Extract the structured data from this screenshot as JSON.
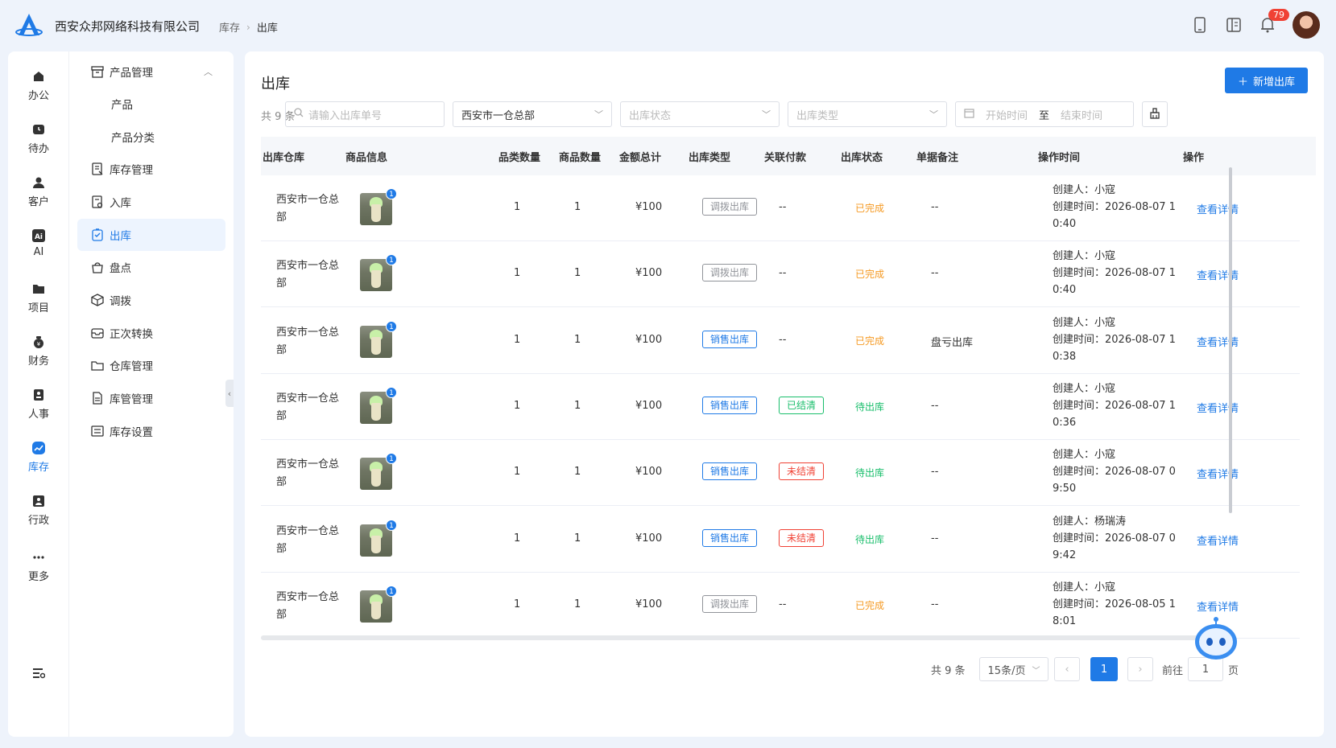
{
  "header": {
    "company": "西安众邦网络科技有限公司",
    "breadcrumb": [
      "库存",
      "出库"
    ],
    "notification_count": "79"
  },
  "rail": [
    {
      "label": "办公",
      "icon": "home-icon"
    },
    {
      "label": "待办",
      "icon": "clock-icon"
    },
    {
      "label": "客户",
      "icon": "user-icon"
    },
    {
      "label": "AI",
      "icon": "ai-icon"
    },
    {
      "label": "项目",
      "icon": "folder-icon"
    },
    {
      "label": "财务",
      "icon": "money-bag-icon"
    },
    {
      "label": "人事",
      "icon": "badge-icon"
    },
    {
      "label": "库存",
      "icon": "trend-icon",
      "active": true
    },
    {
      "label": "行政",
      "icon": "admin-icon"
    },
    {
      "label": "更多",
      "icon": "more-icon"
    }
  ],
  "submenu": [
    {
      "label": "产品管理",
      "icon": "box-icon",
      "expanded": true
    },
    {
      "label": "产品",
      "child": true
    },
    {
      "label": "产品分类",
      "child": true
    },
    {
      "label": "库存管理",
      "icon": "doc-edit-icon"
    },
    {
      "label": "入库",
      "icon": "doc-in-icon"
    },
    {
      "label": "出库",
      "icon": "doc-out-icon",
      "active": true
    },
    {
      "label": "盘点",
      "icon": "bag-icon"
    },
    {
      "label": "调拨",
      "icon": "cube-icon"
    },
    {
      "label": "正次转换",
      "icon": "inbox-icon"
    },
    {
      "label": "仓库管理",
      "icon": "folder-open-icon"
    },
    {
      "label": "库管管理",
      "icon": "file-icon"
    },
    {
      "label": "库存设置",
      "icon": "list-icon"
    }
  ],
  "page": {
    "title": "出库",
    "new_button": "新增出库",
    "total": "共 9 条"
  },
  "filters": {
    "search_placeholder": "请输入出库单号",
    "warehouse": "西安市一仓总部",
    "status_placeholder": "出库状态",
    "type_placeholder": "出库类型",
    "start_placeholder": "开始时间",
    "range_sep": "至",
    "end_placeholder": "结束时间"
  },
  "table": {
    "columns": [
      "出库仓库",
      "商品信息",
      "品类数量",
      "商品数量",
      "金额总计",
      "出库类型",
      "关联付款",
      "出库状态",
      "单据备注",
      "操作时间",
      "操作"
    ],
    "rows": [
      {
        "warehouse": "西安市一仓总部",
        "qty_badge": "1",
        "cat_qty": "1",
        "goods_qty": "1",
        "amount": "¥100",
        "type": "调拨出库",
        "type_color": "gray",
        "payment": "--",
        "payment_tag": "",
        "status": "已完成",
        "status_color": "orange",
        "remark": "--",
        "creator": "创建人：小寇",
        "time": "创建时间：2026-08-07 10:40",
        "action": "查看详情"
      },
      {
        "warehouse": "西安市一仓总部",
        "qty_badge": "1",
        "cat_qty": "1",
        "goods_qty": "1",
        "amount": "¥100",
        "type": "调拨出库",
        "type_color": "gray",
        "payment": "--",
        "payment_tag": "",
        "status": "已完成",
        "status_color": "orange",
        "remark": "--",
        "creator": "创建人：小寇",
        "time": "创建时间：2026-08-07 10:40",
        "action": "查看详情"
      },
      {
        "warehouse": "西安市一仓总部",
        "qty_badge": "1",
        "cat_qty": "1",
        "goods_qty": "1",
        "amount": "¥100",
        "type": "销售出库",
        "type_color": "blue",
        "payment": "--",
        "payment_tag": "",
        "status": "已完成",
        "status_color": "orange",
        "remark": "盘亏出库",
        "creator": "创建人：小寇",
        "time": "创建时间：2026-08-07 10:38",
        "action": "查看详情"
      },
      {
        "warehouse": "西安市一仓总部",
        "qty_badge": "1",
        "cat_qty": "1",
        "goods_qty": "1",
        "amount": "¥100",
        "type": "销售出库",
        "type_color": "blue",
        "payment": "已结清",
        "payment_tag": "green",
        "status": "待出库",
        "status_color": "green",
        "remark": "--",
        "creator": "创建人：小寇",
        "time": "创建时间：2026-08-07 10:36",
        "action": "查看详情"
      },
      {
        "warehouse": "西安市一仓总部",
        "qty_badge": "1",
        "cat_qty": "1",
        "goods_qty": "1",
        "amount": "¥100",
        "type": "销售出库",
        "type_color": "blue",
        "payment": "未结清",
        "payment_tag": "red",
        "status": "待出库",
        "status_color": "green",
        "remark": "--",
        "creator": "创建人：小寇",
        "time": "创建时间：2026-08-07 09:50",
        "action": "查看详情"
      },
      {
        "warehouse": "西安市一仓总部",
        "qty_badge": "1",
        "cat_qty": "1",
        "goods_qty": "1",
        "amount": "¥100",
        "type": "销售出库",
        "type_color": "blue",
        "payment": "未结清",
        "payment_tag": "red",
        "status": "待出库",
        "status_color": "green",
        "remark": "--",
        "creator": "创建人：杨瑞涛",
        "time": "创建时间：2026-08-07 09:42",
        "action": "查看详情"
      },
      {
        "warehouse": "西安市一仓总部",
        "qty_badge": "1",
        "cat_qty": "1",
        "goods_qty": "1",
        "amount": "¥100",
        "type": "调拨出库",
        "type_color": "gray",
        "payment": "--",
        "payment_tag": "",
        "status": "已完成",
        "status_color": "orange",
        "remark": "--",
        "creator": "创建人：小寇",
        "time": "创建时间：2026-08-05 18:01",
        "action": "查看详情"
      }
    ]
  },
  "pagination": {
    "total": "共 9 条",
    "page_size": "15条/页",
    "current": "1",
    "goto_label": "前往",
    "goto_value": "1",
    "page_suffix": "页"
  }
}
